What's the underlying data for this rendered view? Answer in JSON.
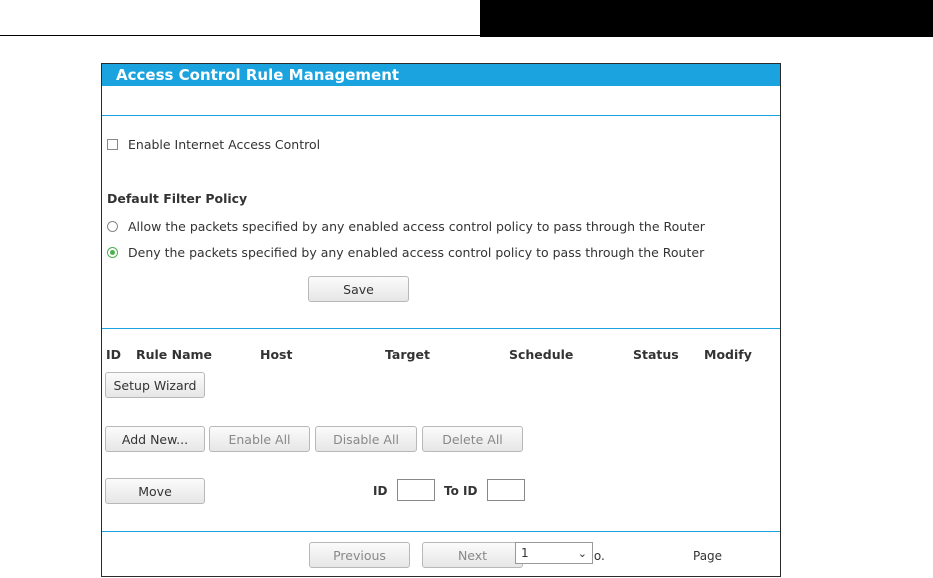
{
  "panel": {
    "title": "Access Control Rule Management"
  },
  "enable": {
    "label": "Enable Internet Access Control",
    "checked": false
  },
  "filter": {
    "heading": "Default Filter Policy",
    "allow_label": "Allow the packets specified by any enabled access control policy to pass through the Router",
    "deny_label": "Deny the packets specified by any enabled access control policy to pass through the Router",
    "selected": "deny"
  },
  "save_label": "Save",
  "table": {
    "columns": [
      "ID",
      "Rule Name",
      "Host",
      "Target",
      "Schedule",
      "Status",
      "Modify"
    ]
  },
  "buttons": {
    "setup_wizard": "Setup Wizard",
    "add_new": "Add New...",
    "enable_all": "Enable All",
    "disable_all": "Disable All",
    "delete_all": "Delete All",
    "move": "Move"
  },
  "move": {
    "id_label": "ID",
    "to_id_label": "To ID",
    "id_value": "",
    "to_id_value": ""
  },
  "pager": {
    "previous": "Previous",
    "next": "Next",
    "current_label": "Current No.",
    "current_value": "1",
    "page_label": "Page"
  },
  "colors": {
    "accent": "#1aa3df",
    "radio_checked": "#4caf50"
  }
}
